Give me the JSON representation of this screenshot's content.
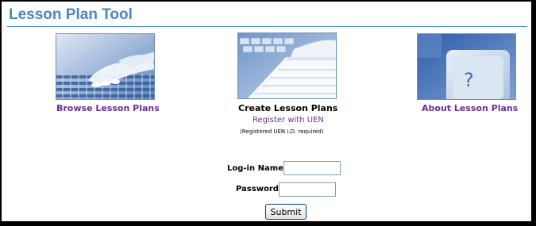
{
  "header": {
    "title": "Lesson Plan Tool"
  },
  "sections": {
    "browse": {
      "label": "Browse Lesson Plans"
    },
    "create": {
      "label": "Create Lesson Plans",
      "register_link": "Register with UEN",
      "note": "(Registered UEN I.D. required)"
    },
    "about": {
      "label": "About Lesson Plans"
    }
  },
  "login": {
    "name_label": "Log-in Name:",
    "name_value": "",
    "password_label": "Password:",
    "password_value": "",
    "submit_label": "Submit"
  },
  "colors": {
    "title": "#4a86c7",
    "link": "#6b2e8f",
    "image_tint": "#3d6fb3"
  }
}
